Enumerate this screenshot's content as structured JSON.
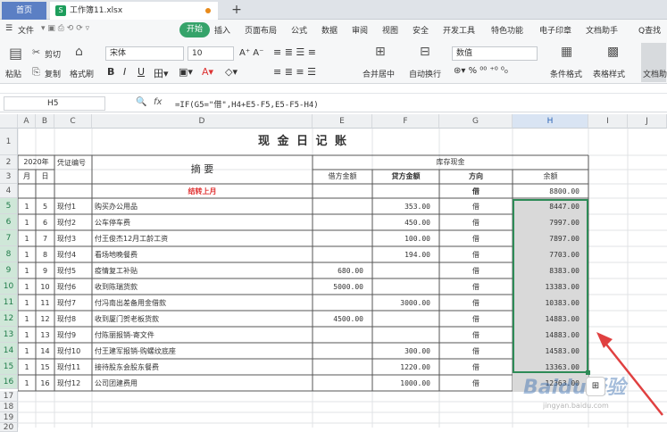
{
  "tabs": {
    "home": "首页",
    "file": "工作簿11.xlsx",
    "add": "+"
  },
  "menu": {
    "file": "文件",
    "start": "开始",
    "items": [
      "插入",
      "页面布局",
      "公式",
      "数据",
      "审阅",
      "视图",
      "安全",
      "开发工具",
      "特色功能",
      "电子印章",
      "文档助手"
    ],
    "search": "Q查找"
  },
  "ribbon": {
    "paste": "粘贴",
    "cut": "剪切",
    "copy": "复制",
    "format_painter": "格式刷",
    "font_name": "宋体",
    "font_size": "10",
    "merge": "合并居中",
    "wrap": "自动换行",
    "number_format": "数值",
    "cond_format": "条件格式",
    "table_style": "表格样式",
    "doc_assistant": "文档助手"
  },
  "formula_bar": {
    "cell_ref": "H5",
    "fx": "fx",
    "formula": "=IF(G5=\"借\",H4+E5-F5,E5-F5-H4)"
  },
  "columns": [
    "A",
    "B",
    "C",
    "D",
    "E",
    "F",
    "G",
    "H",
    "I",
    "J"
  ],
  "rows": [
    "1",
    "2",
    "3",
    "4",
    "5",
    "6",
    "7",
    "8",
    "9",
    "10",
    "11",
    "12",
    "13",
    "14",
    "15",
    "16",
    "17",
    "18",
    "19",
    "20"
  ],
  "sheet": {
    "title": "现 金 日 记 账",
    "year": "2020年",
    "month": "月",
    "day": "日",
    "voucher": "凭证编号",
    "summary": "摘        要",
    "storage": "库存现金",
    "debit": "借方金额",
    "credit": "贷方金额",
    "direction": "方向",
    "balance": "余额",
    "carry_label": "结转上月",
    "carry_dir": "借",
    "carry_balance": "8800.00",
    "entries": [
      {
        "m": "1",
        "d": "5",
        "v": "现付1",
        "s": "购买办公用品",
        "e": "",
        "f": "353.00",
        "g": "借",
        "h": "8447.00"
      },
      {
        "m": "1",
        "d": "6",
        "v": "现付2",
        "s": "公车停车费",
        "e": "",
        "f": "450.00",
        "g": "借",
        "h": "7997.00"
      },
      {
        "m": "1",
        "d": "7",
        "v": "现付3",
        "s": "付王俊杰12月工龄工资",
        "e": "",
        "f": "100.00",
        "g": "借",
        "h": "7897.00"
      },
      {
        "m": "1",
        "d": "8",
        "v": "现付4",
        "s": "看场地晚餐费",
        "e": "",
        "f": "194.00",
        "g": "借",
        "h": "7703.00"
      },
      {
        "m": "1",
        "d": "9",
        "v": "现付5",
        "s": "疫情复工补贴",
        "e": "680.00",
        "f": "",
        "g": "借",
        "h": "8383.00"
      },
      {
        "m": "1",
        "d": "10",
        "v": "现付6",
        "s": "收到陈瑞货款",
        "e": "5000.00",
        "f": "",
        "g": "借",
        "h": "13383.00"
      },
      {
        "m": "1",
        "d": "11",
        "v": "现付7",
        "s": "付冯南出差备用金借款",
        "e": "",
        "f": "3000.00",
        "g": "借",
        "h": "10383.00"
      },
      {
        "m": "1",
        "d": "12",
        "v": "现付8",
        "s": "收到厦门贺老板货款",
        "e": "4500.00",
        "f": "",
        "g": "借",
        "h": "14883.00"
      },
      {
        "m": "1",
        "d": "13",
        "v": "现付9",
        "s": "付陈丽报销-寄文件",
        "e": "",
        "f": "",
        "g": "借",
        "h": "14883.00"
      },
      {
        "m": "1",
        "d": "14",
        "v": "现付10",
        "s": "付王建军报销-购螺纹底座",
        "e": "",
        "f": "300.00",
        "g": "借",
        "h": "14583.00"
      },
      {
        "m": "1",
        "d": "15",
        "v": "现付11",
        "s": "接待股东会股东餐费",
        "e": "",
        "f": "1220.00",
        "g": "借",
        "h": "13363.00"
      },
      {
        "m": "1",
        "d": "16",
        "v": "现付12",
        "s": "公司团建费用",
        "e": "",
        "f": "1000.00",
        "g": "借",
        "h": "12363.00"
      }
    ]
  },
  "colors": {
    "accent_green": "#35a36a",
    "tab_blue": "#5b7fc4",
    "selection_border": "#2e8b57",
    "arrow": "#e04040"
  },
  "watermark": {
    "brand": "Baidu经验",
    "url": "jingyan.baidu.com"
  }
}
